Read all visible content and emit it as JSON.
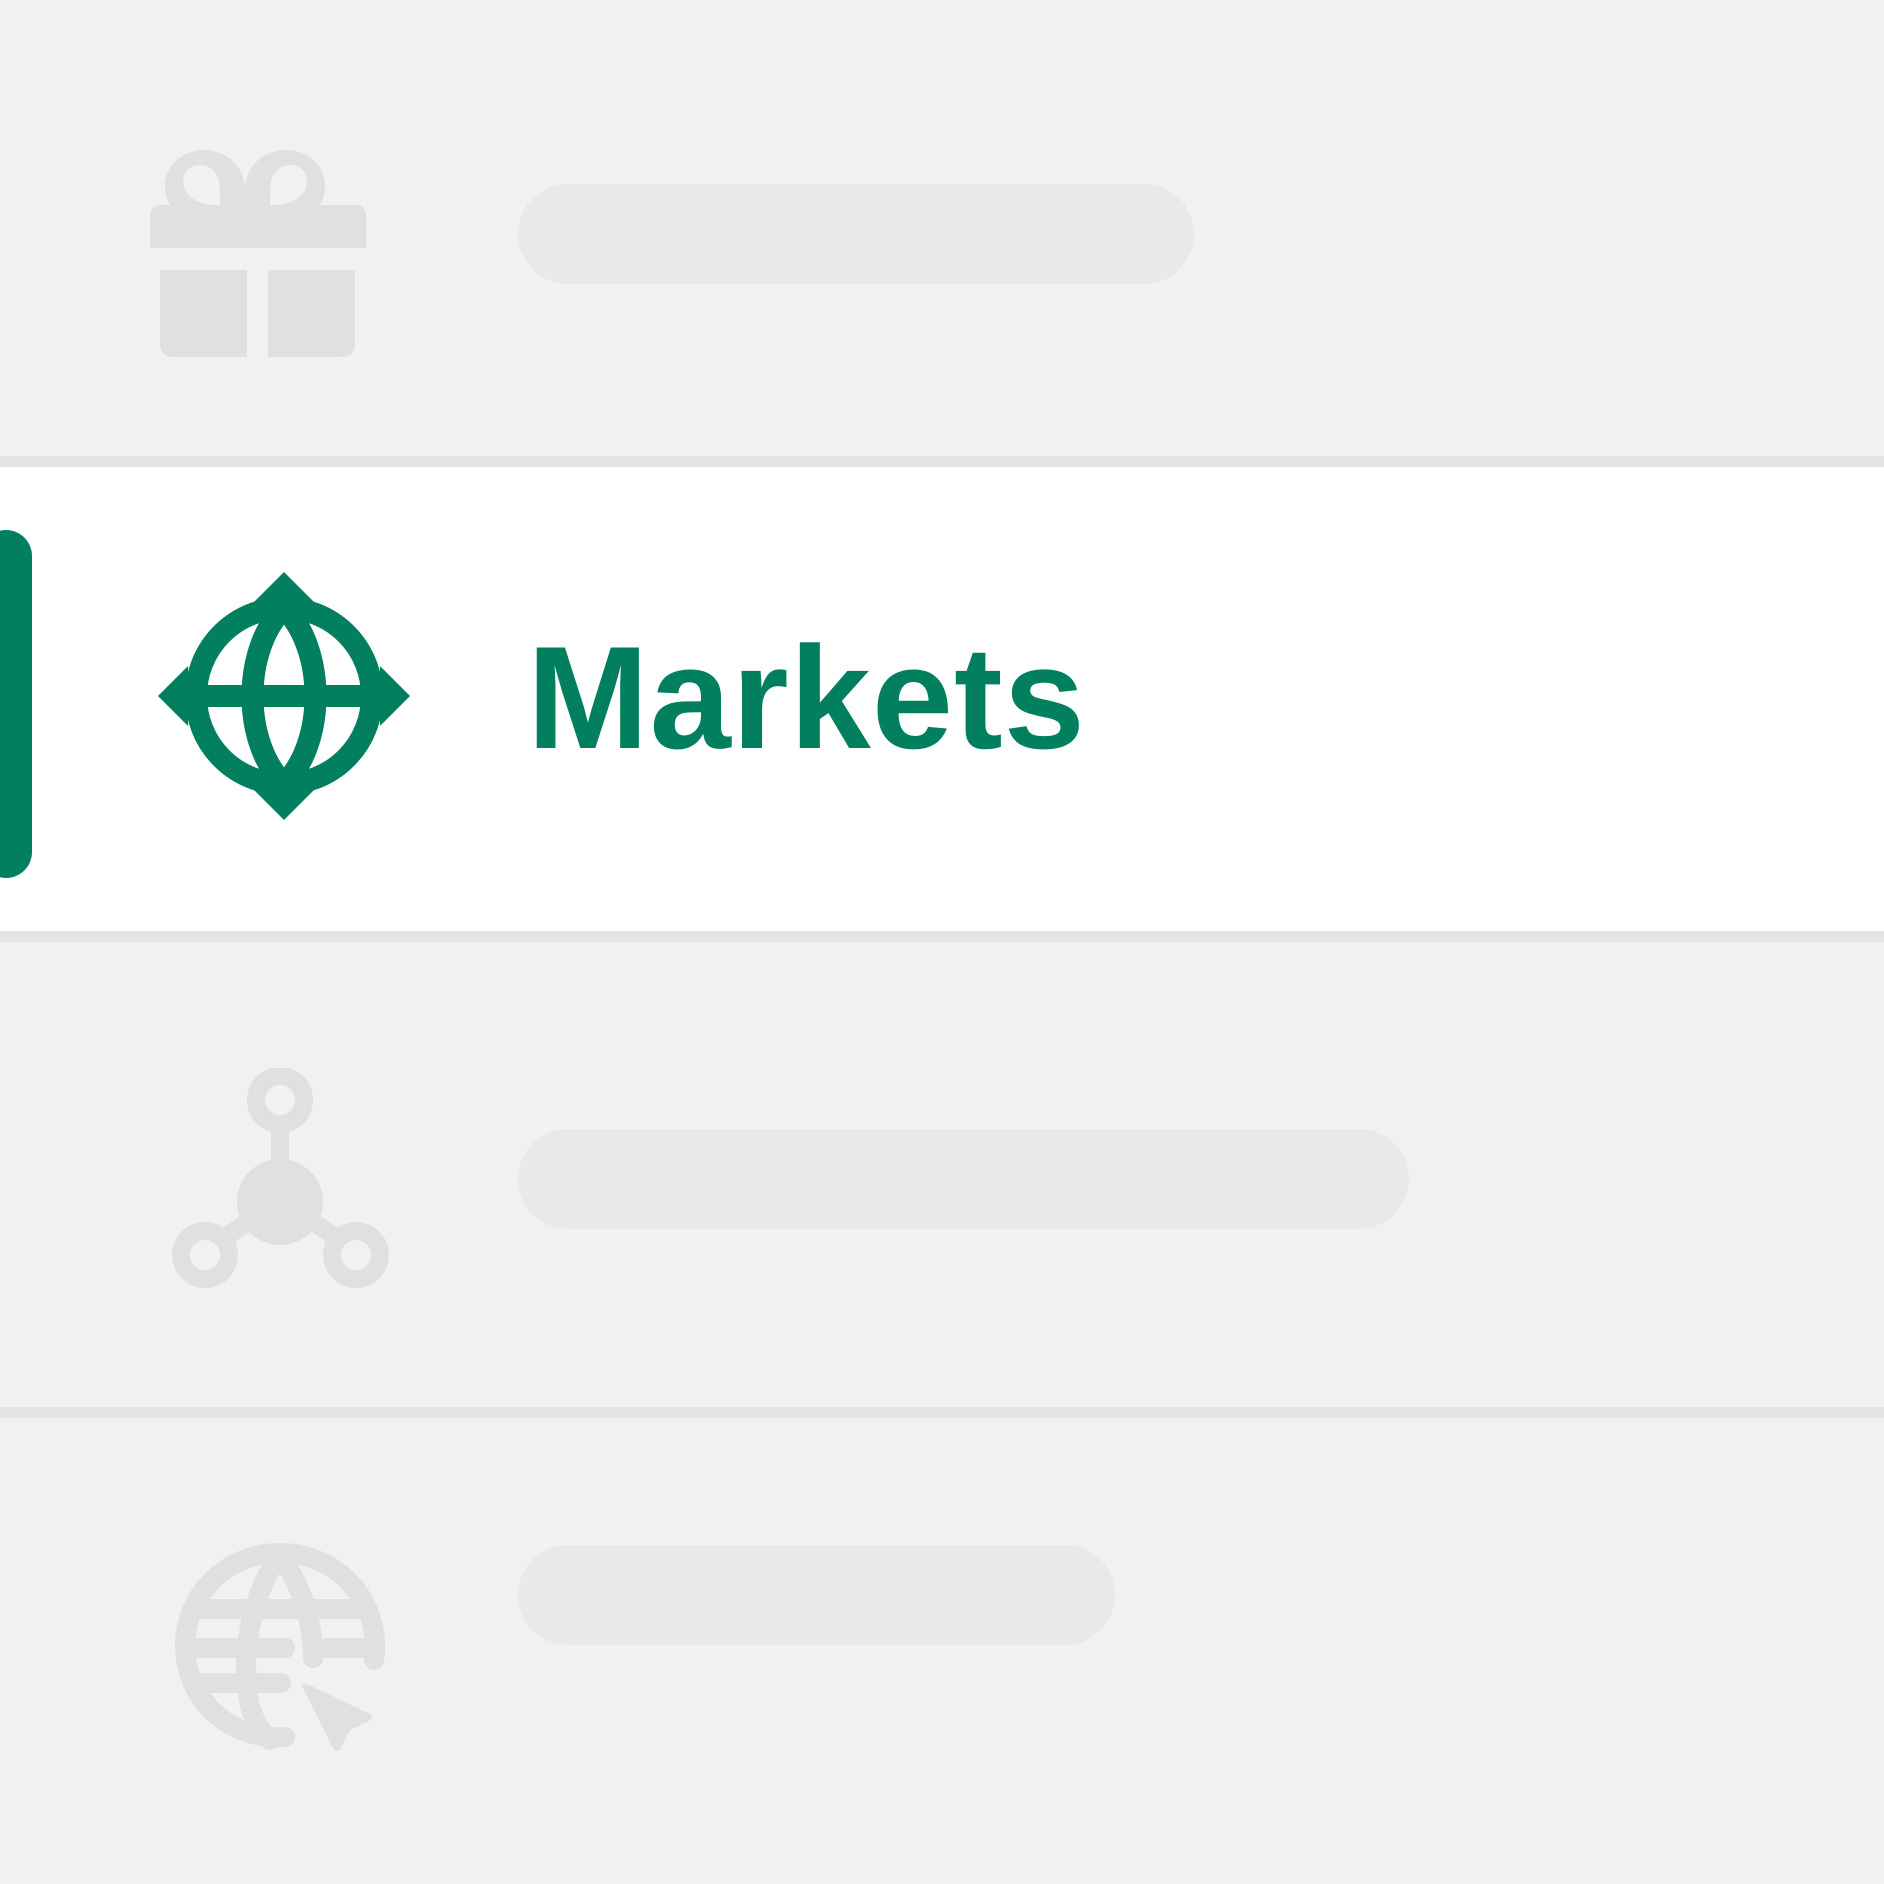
{
  "colors": {
    "accent": "#027f5e",
    "inactive_icon": "#dfe0e2",
    "skeleton": "#e9e9e9",
    "active_row_background": "#ffffff",
    "row_background": "#f1f1f1",
    "divider": "#e4e4e4"
  },
  "menu": {
    "items": [
      {
        "icon": "gift-icon",
        "label": "",
        "state": "loading"
      },
      {
        "icon": "markets-icon",
        "label": "Markets",
        "state": "active"
      },
      {
        "icon": "network-icon",
        "label": "",
        "state": "loading"
      },
      {
        "icon": "globe-cursor-icon",
        "label": "",
        "state": "loading"
      }
    ]
  }
}
